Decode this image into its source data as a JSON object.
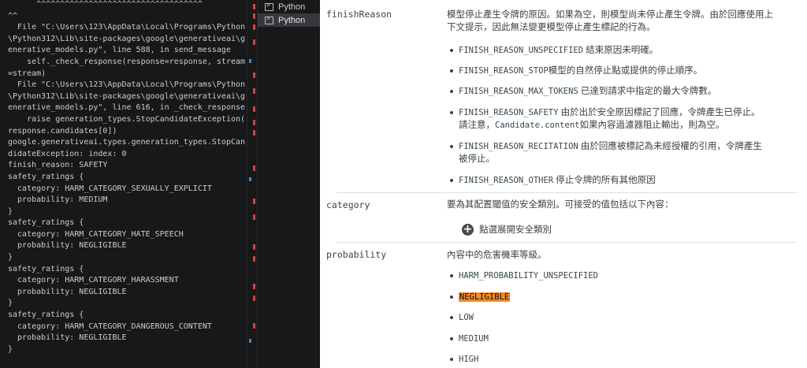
{
  "terminal": {
    "lines": [
      "      ^^^^^^^^^^^^^^^^^^^^^^^^^^^^^^^^^^^",
      "^^",
      "  File \"C:\\Users\\123\\AppData\\Local\\Programs\\Python",
      "\\Python312\\Lib\\site-packages\\google\\generativeai\\g",
      "enerative_models.py\", line 588, in send_message",
      "    self._check_response(response=response, stream",
      "=stream)",
      "  File \"C:\\Users\\123\\AppData\\Local\\Programs\\Python",
      "\\Python312\\Lib\\site-packages\\google\\generativeai\\g",
      "enerative_models.py\", line 616, in _check_response",
      "    raise generation_types.StopCandidateException(",
      "response.candidates[0])",
      "google.generativeai.types.generation_types.StopCan",
      "didateException: index: 0",
      "finish_reason: SAFETY",
      "safety_ratings {",
      "  category: HARM_CATEGORY_SEXUALLY_EXPLICIT",
      "  probability: MEDIUM",
      "}",
      "safety_ratings {",
      "  category: HARM_CATEGORY_HATE_SPEECH",
      "  probability: NEGLIGIBLE",
      "}",
      "safety_ratings {",
      "  category: HARM_CATEGORY_HARASSMENT",
      "  probability: NEGLIGIBLE",
      "}",
      "safety_ratings {",
      "  category: HARM_CATEGORY_DANGEROUS_CONTENT",
      "  probability: NEGLIGIBLE",
      "}"
    ]
  },
  "terminal_tabs": [
    {
      "label": "Python",
      "icon": "terminal-icon"
    },
    {
      "label": "Python",
      "icon": "terminal-icon"
    }
  ],
  "colors": {
    "accent_highlight": "#f28c28",
    "scrollbar_error": "#d14343",
    "scrollbar_info": "#3a8fd1"
  },
  "doc": {
    "finishReason": {
      "name": "finishReason",
      "description": "模型停止產生令牌的原因。如果為空，則模型尚未停止產生令牌。由於回應使用上下文提示，因此無法變更模型停止產生標記的行為。",
      "items": [
        {
          "code": "FINISH_REASON_UNSPECIFIED",
          "text": " 結束原因未明確。"
        },
        {
          "code": "FINISH_REASON_STOP",
          "text": "模型的自然停止點或提供的停止順序。"
        },
        {
          "code": "FINISH_REASON_MAX_TOKENS",
          "text": " 已達到請求中指定的最大令牌數。"
        },
        {
          "code": "FINISH_REASON_SAFETY",
          "text": " 由於出於安全原因標記了回應，令牌產生已停止。請注意，",
          "code2": "Candidate.content",
          "text2": "如果內容過濾器阻止輸出，則為空。"
        },
        {
          "code": "FINISH_REASON_RECITATION",
          "text": " 由於回應被標記為未經授權的引用，令牌產生被停止。"
        },
        {
          "code": "FINISH_REASON_OTHER",
          "text": " 停止令牌的所有其他原因"
        }
      ]
    },
    "category": {
      "name": "category",
      "description": "要為其配置閾值的安全類別。可接受的值包括以下內容：",
      "expand_label": "點選展開安全類別"
    },
    "probability": {
      "name": "probability",
      "description": "內容中的危害機率等級。",
      "items": [
        "HARM_PROBABILITY_UNSPECIFIED",
        "NEGLIGIBLE",
        "LOW",
        "MEDIUM",
        "HIGH"
      ]
    }
  }
}
